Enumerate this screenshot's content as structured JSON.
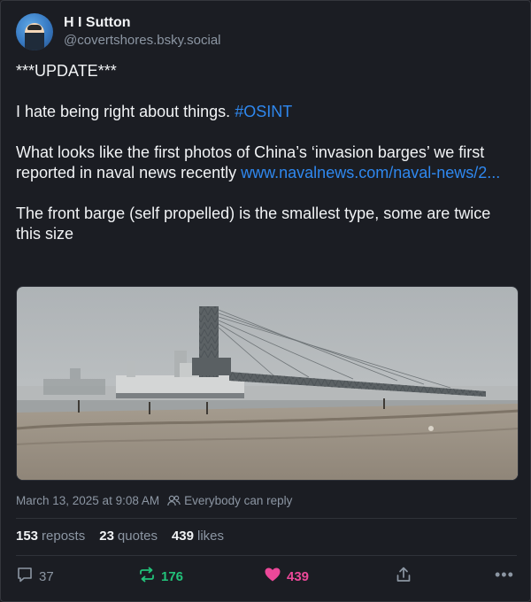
{
  "author": {
    "display_name": "H I Sutton",
    "handle": "@covertshores.bsky.social",
    "avatar_icon": "person-avatar"
  },
  "post": {
    "line1": "***UPDATE***",
    "line2_text": "I hate being right about things. ",
    "line2_hashtag": "#OSINT",
    "para3_text": "What looks like the first photos of China’s ‘invasion barges’ we first reported in naval news recently ",
    "para3_link": "www.navalnews.com/naval-news/2...",
    "para4": "The front barge (self propelled) is the smallest type, some are twice this size"
  },
  "meta": {
    "timestamp": "March 13, 2025 at 9:08 AM",
    "reply_setting": "Everybody can reply"
  },
  "stats": {
    "reposts_count": "153",
    "reposts_label": "reposts",
    "quotes_count": "23",
    "quotes_label": "quotes",
    "likes_count": "439",
    "likes_label": "likes"
  },
  "actions": {
    "reply_count": "37",
    "repost_count": "176",
    "like_count": "439"
  },
  "colors": {
    "background": "#1b1d23",
    "link": "#2f88ef",
    "repost_active": "#22c27a",
    "like_active": "#ec4899"
  }
}
